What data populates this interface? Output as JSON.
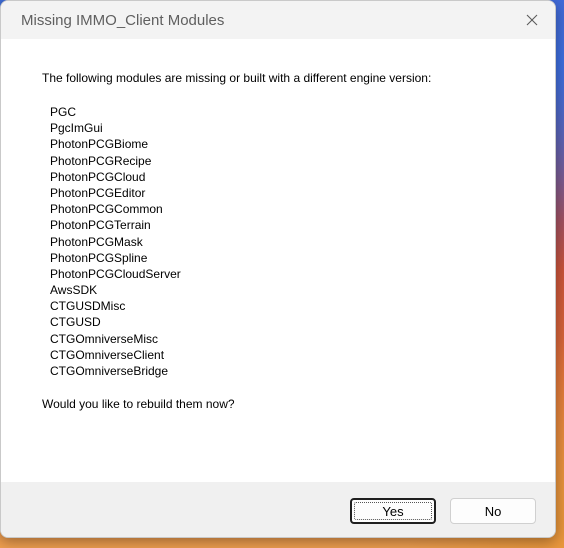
{
  "window": {
    "title": "Missing IMMO_Client Modules",
    "close_icon": "close-icon"
  },
  "message": {
    "intro": "The following modules are missing or built with a different engine version:",
    "modules": [
      "PGC",
      "PgcImGui",
      "PhotonPCGBiome",
      "PhotonPCGRecipe",
      "PhotonPCGCloud",
      "PhotonPCGEditor",
      "PhotonPCGCommon",
      "PhotonPCGTerrain",
      "PhotonPCGMask",
      "PhotonPCGSpline",
      "PhotonPCGCloudServer",
      "AwsSDK",
      "CTGUSDMisc",
      "CTGUSD",
      "CTGOmniverseMisc",
      "CTGOmniverseClient",
      "CTGOmniverseBridge"
    ],
    "question": "Would you like to rebuild them now?"
  },
  "buttons": {
    "yes_label": "Yes",
    "no_label": "No",
    "default": "yes"
  },
  "colors": {
    "titlebar": "#f3f3f3",
    "content": "#ffffff",
    "footer": "#f0f0f0",
    "title_text": "#5f5f5f"
  }
}
